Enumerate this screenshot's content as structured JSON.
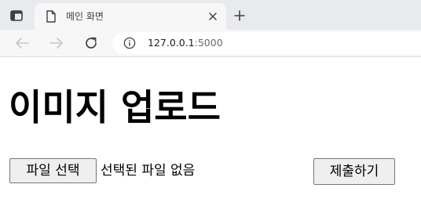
{
  "browser": {
    "tab": {
      "title": "메인 화면"
    },
    "address_bar": {
      "host": "127.0.0.1",
      "port": ":5000"
    },
    "icons": {
      "tab_actions": "tab-actions-icon",
      "favicon": "document-icon",
      "close": "close-icon",
      "new_tab": "plus-icon",
      "back": "arrow-left-icon",
      "forward": "arrow-right-icon",
      "reload": "reload-icon",
      "site_info": "info-icon"
    }
  },
  "page": {
    "title": "이미지 업로드",
    "form": {
      "file_button_label": "파일 선택",
      "file_status": "선택된 파일 없음",
      "submit_label": "제출하기"
    }
  }
}
